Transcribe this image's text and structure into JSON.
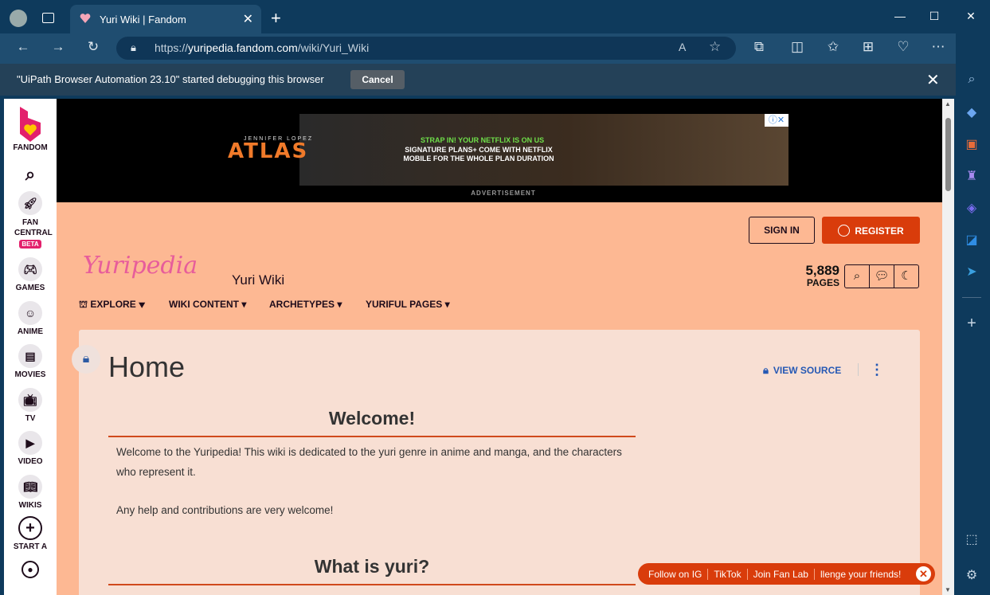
{
  "browser": {
    "tab_title": "Yuri Wiki | Fandom",
    "url_prefix": "https://",
    "url_host": "yuripedia.fandom.com",
    "url_path": "/wiki/Yuri_Wiki",
    "icons": [
      "back-icon",
      "forward-icon",
      "refresh-icon",
      "read-aloud-icon",
      "favorite-icon",
      "extensions-icon",
      "split-screen-icon",
      "favorites-icon",
      "collections-icon",
      "browser-essentials-icon",
      "more-icon",
      "copilot-icon"
    ]
  },
  "debug_bar": {
    "message": "\"UiPath Browser Automation 23.10\" started debugging this browser",
    "cancel_label": "Cancel"
  },
  "fandom_rail": {
    "logo_label": "FANDOM",
    "items": [
      {
        "label": "FAN CENTRAL",
        "badge": "BETA"
      },
      {
        "label": "GAMES"
      },
      {
        "label": "ANIME"
      },
      {
        "label": "MOVIES"
      },
      {
        "label": "TV"
      },
      {
        "label": "VIDEO"
      },
      {
        "label": "WIKIS"
      },
      {
        "label": "START A"
      }
    ]
  },
  "ad": {
    "brand_small": "JENNIFER LOPEZ",
    "brand": "ATLAS",
    "headline": "STRAP IN! YOUR NETFLIX IS ON US",
    "body": "SIGNATURE PLANS+ COME WITH NETFLIX MOBILE FOR THE WHOLE PLAN DURATION",
    "label": "ADVERTISEMENT"
  },
  "header": {
    "sign_in": "SIGN IN",
    "register": "REGISTER",
    "logo_text": "Yuripedia",
    "wiki_name": "Yuri Wiki",
    "page_count": "5,889",
    "page_count_label": "PAGES"
  },
  "nav": [
    "EXPLORE",
    "WIKI CONTENT",
    "ARCHETYPES",
    "YURIFUL PAGES"
  ],
  "article": {
    "title": "Home",
    "view_source": "VIEW SOURCE",
    "h2_welcome": "Welcome!",
    "p1": "Welcome to the Yuripedia! This wiki is dedicated to the yuri genre in anime and manga, and the characters who represent it.",
    "p2": "Any help and contributions are very welcome!",
    "h2_what": "What is yuri?"
  },
  "follow_bar": [
    "Follow on IG",
    "TikTok",
    "Join Fan Lab",
    "llenge your friends!"
  ],
  "colors": {
    "accent": "#d93c0b",
    "page_bg": "#fdb893",
    "content_bg": "#f8dfd3",
    "browser_frame": "#0e3a5c"
  }
}
